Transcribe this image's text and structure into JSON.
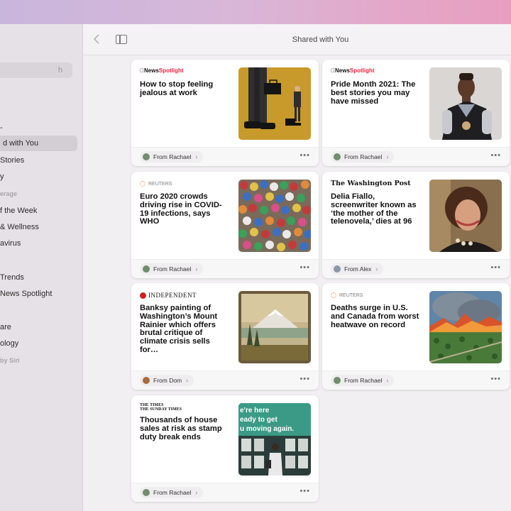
{
  "window": {
    "title": "Shared with You"
  },
  "sidebar": {
    "search_placeholder": "h",
    "items": [
      {
        "label": "d with You",
        "selected": true
      },
      {
        "label": "Stories"
      },
      {
        "label": "y"
      },
      {
        "label": "erage",
        "heading": true
      },
      {
        "label": "f the Week"
      },
      {
        "label": "& Wellness"
      },
      {
        "label": "avirus"
      },
      {
        "label": "Trends"
      },
      {
        "label": "News Spotlight"
      },
      {
        "label": "are"
      },
      {
        "label": "ology"
      },
      {
        "label": "by Siri",
        "heading": true
      }
    ],
    "dash": "-"
  },
  "cards": [
    {
      "source": "apple_news",
      "source_text": [
        "News",
        "Spotlight"
      ],
      "title": "How to stop feeling jealous at work",
      "from": "From Rachael",
      "avatar_color": "#6e8f6a",
      "image": "jealous"
    },
    {
      "source": "apple_news",
      "source_text": [
        "News",
        "Spotlight"
      ],
      "title": "Pride Month 2021: The best stories you may have missed",
      "from": "From Rachael",
      "avatar_color": "#6e8f6a",
      "image": "pride"
    },
    {
      "source": "reuters",
      "source_text": [
        "REUTERS"
      ],
      "title": "Euro 2020 crowds driving rise in COVID-19 infections, says WHO",
      "from": "From Rachael",
      "avatar_color": "#6e8f6a",
      "image": "crowd"
    },
    {
      "source": "wapo",
      "source_text": [
        "The Washington Post"
      ],
      "title": "Delia Fiallo, screenwriter known as ‘the mother of the telenovela,’ dies at 96",
      "from": "From Alex",
      "avatar_color": "#8b98a8",
      "image": "delia"
    },
    {
      "source": "independent",
      "source_text": [
        "INDEPENDENT"
      ],
      "title": "Banksy painting of Washington’s Mount Rainier which offers brutal critique of climate crisis sells for…",
      "from": "From Dom",
      "avatar_color": "#a86b3c",
      "image": "painting"
    },
    {
      "source": "reuters",
      "source_text": [
        "REUTERS"
      ],
      "title": "Deaths surge in U.S. and Canada from worst heatwave on record",
      "from": "From Rachael",
      "avatar_color": "#6e8f6a",
      "image": "fire"
    },
    {
      "source": "times",
      "source_text": [
        "THE TIMES",
        "THE SUNDAY TIMES"
      ],
      "title": "Thousands of house sales at risk as stamp duty break ends",
      "from": "From Rachael",
      "avatar_color": "#6e8f6a",
      "image": "houses",
      "image_text": [
        "e're here",
        "eady to get",
        "u moving again."
      ]
    }
  ],
  "more_label": "•••",
  "chevron": "›"
}
